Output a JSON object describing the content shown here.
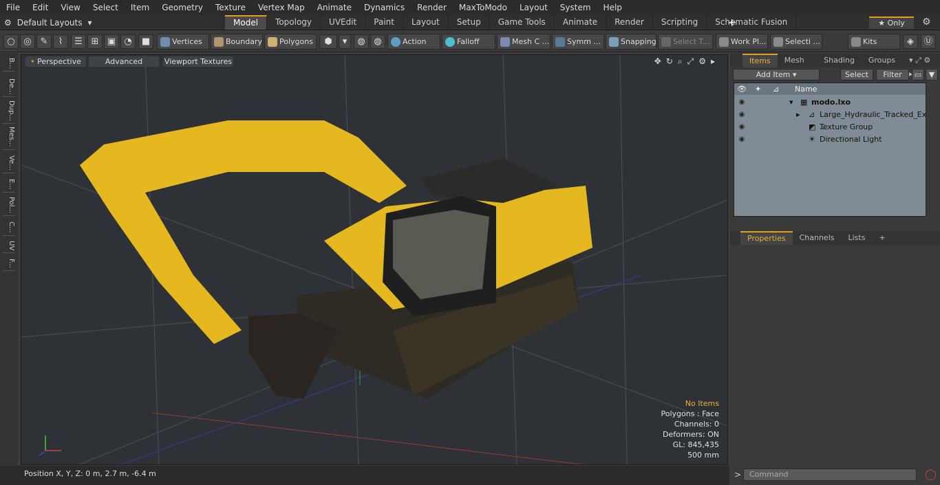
{
  "menu": [
    "File",
    "Edit",
    "View",
    "Select",
    "Item",
    "Geometry",
    "Texture",
    "Vertex Map",
    "Animate",
    "Dynamics",
    "Render",
    "MaxToModo",
    "Layout",
    "System",
    "Help"
  ],
  "layouts_label": "Default Layouts",
  "tabs": [
    "Model",
    "Topology",
    "UVEdit",
    "Paint",
    "Layout",
    "Setup",
    "Game Tools",
    "Animate",
    "Render",
    "Scripting",
    "Schematic Fusion"
  ],
  "only_label": "Only",
  "toolbar": {
    "vertices": "Vertices",
    "boundary": "Boundary",
    "polygons": "Polygons",
    "action": "Action",
    "falloff": "Falloff",
    "mesh": "Mesh C ...",
    "symm": "Symm ...",
    "snapping": "Snapping",
    "select_t": "Select T...",
    "work_pl": "Work Pl...",
    "selecti": "Selecti ...",
    "kits": "Kits"
  },
  "left_tabs": [
    "B...",
    "De...",
    "Dup...",
    "Mes...",
    "Ve...",
    "E...",
    "Pol...",
    "C...",
    "UV",
    "F..."
  ],
  "viewport": {
    "perspective": "Perspective",
    "advanced": "Advanced",
    "viewport_textures": "Viewport Textures",
    "stats": {
      "items": "No Items",
      "polygons": "Polygons : Face",
      "channels": "Channels: 0",
      "deformers": "Deformers: ON",
      "gl": "GL: 845,435",
      "scale": "500 mm"
    }
  },
  "status": {
    "position": "Position X, Y, Z:   0 m, 2.7 m, -6.4 m"
  },
  "panel": {
    "tabs": [
      "Items",
      "Mesh ...",
      "Shading",
      "Groups"
    ],
    "add_item": "Add Item",
    "select": "Select",
    "filter": "Filter",
    "name_col": "Name",
    "tree": [
      "modo.lxo",
      "Large_Hydraulic_Tracked_Ex ...",
      "Texture Group",
      "Directional Light"
    ],
    "props_tabs": [
      "Properties",
      "Channels",
      "Lists"
    ],
    "command_placeholder": "Command"
  },
  "colors": {
    "accent": "#e0a020",
    "excavator": "#e6b81f"
  }
}
